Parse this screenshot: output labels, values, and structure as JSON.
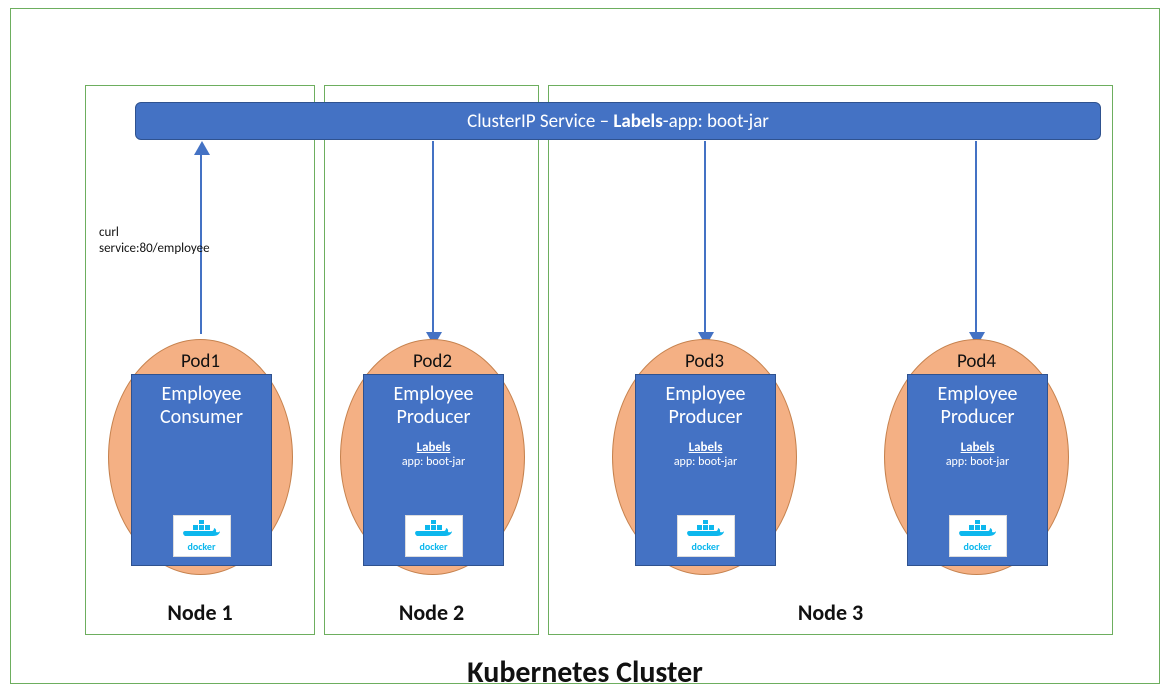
{
  "title": "Kubernetes Cluster",
  "service": {
    "prefix": "ClusterIP Service – ",
    "bold": "Labels",
    "suffix": "-app: boot-jar"
  },
  "curl": {
    "line1": "curl",
    "line2": "service:80/employee"
  },
  "docker_text": "docker",
  "nodes": [
    {
      "label": "Node 1"
    },
    {
      "label": "Node 2"
    },
    {
      "label": "Node 3"
    }
  ],
  "pods": [
    {
      "name": "Pod1",
      "container": "Employee Consumer",
      "labels_title": "",
      "labels_value": ""
    },
    {
      "name": "Pod2",
      "container": "Employee Producer",
      "labels_title": "Labels",
      "labels_value": "app: boot-jar"
    },
    {
      "name": "Pod3",
      "container": "Employee Producer",
      "labels_title": "Labels",
      "labels_value": "app: boot-jar"
    },
    {
      "name": "Pod4",
      "container": "Employee Producer",
      "labels_title": "Labels",
      "labels_value": "app: boot-jar"
    }
  ]
}
